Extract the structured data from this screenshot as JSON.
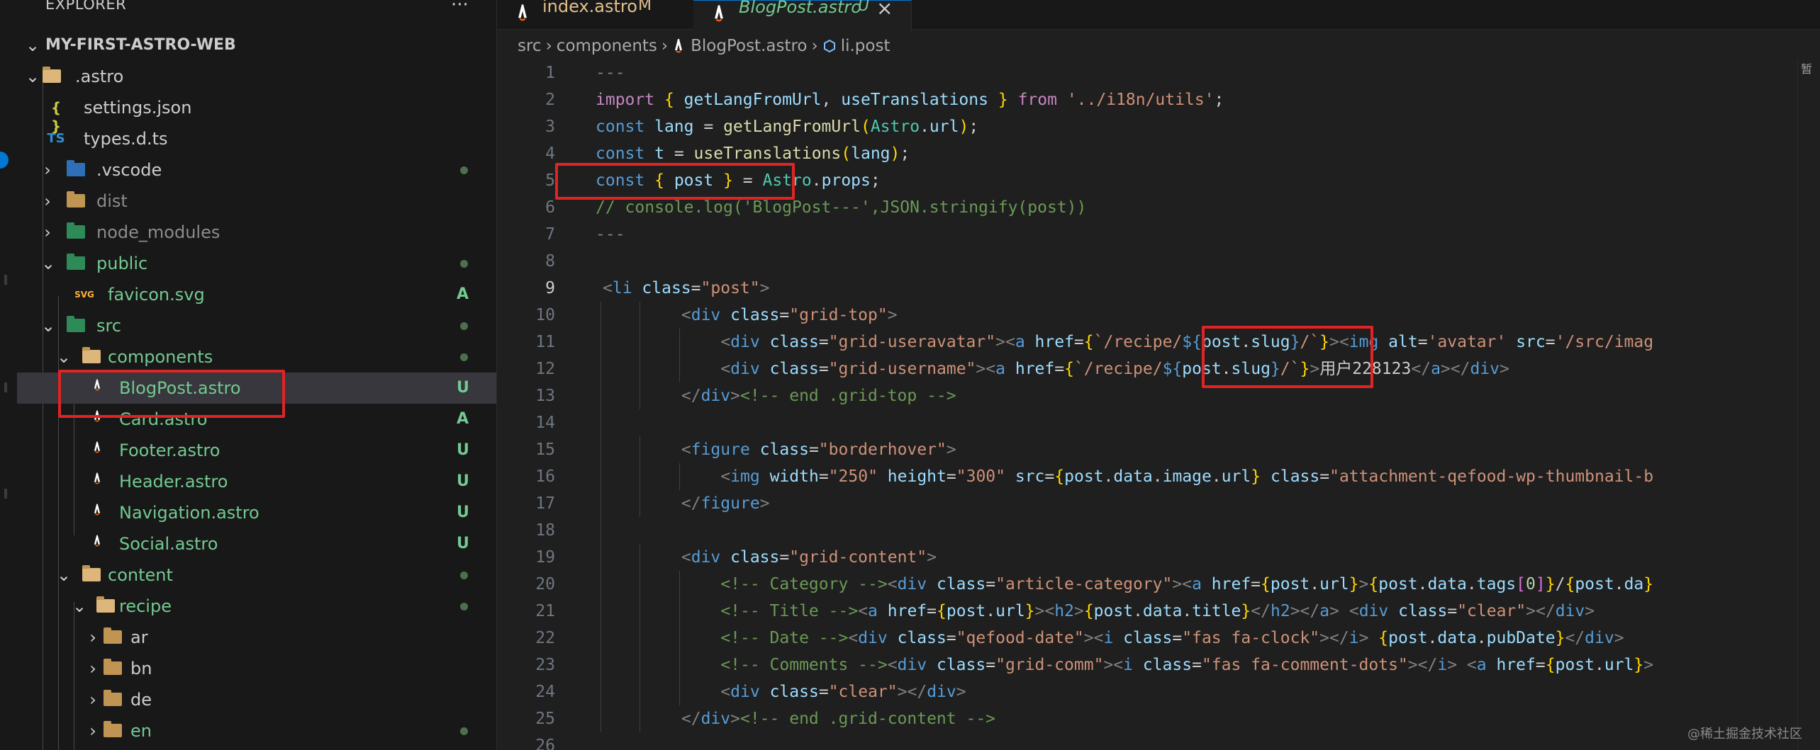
{
  "explorer": {
    "title": "EXPLORER",
    "more": "···",
    "tree": [
      {
        "label": "MY-FIRST-ASTRO-WEB",
        "badge": ""
      },
      {
        "label": ".astro",
        "badge": ""
      },
      {
        "label": "settings.json",
        "icon": "{ }",
        "badge": ""
      },
      {
        "label": "types.d.ts",
        "icon": "TS",
        "badge": ""
      },
      {
        "label": ".vscode",
        "badge": ""
      },
      {
        "label": "dist",
        "badge": ""
      },
      {
        "label": "node_modules",
        "badge": ""
      },
      {
        "label": "public",
        "badge": ""
      },
      {
        "label": "favicon.svg",
        "icon": "SVG",
        "badge": "A"
      },
      {
        "label": "src",
        "badge": ""
      },
      {
        "label": "components",
        "badge": ""
      },
      {
        "label": "BlogPost.astro",
        "badge": "U"
      },
      {
        "label": "Card.astro",
        "badge": "A"
      },
      {
        "label": "Footer.astro",
        "badge": "U"
      },
      {
        "label": "Header.astro",
        "badge": "U"
      },
      {
        "label": "Navigation.astro",
        "badge": "U"
      },
      {
        "label": "Social.astro",
        "badge": "U"
      },
      {
        "label": "content",
        "badge": ""
      },
      {
        "label": "recipe",
        "badge": ""
      },
      {
        "label": "ar",
        "badge": ""
      },
      {
        "label": "bn",
        "badge": ""
      },
      {
        "label": "de",
        "badge": ""
      },
      {
        "label": "en",
        "badge": ""
      }
    ]
  },
  "tabs": [
    {
      "label": "index.astro",
      "status": "M"
    },
    {
      "label": "BlogPost.astro",
      "status": "U",
      "close": "×"
    }
  ],
  "breadcrumb": {
    "items": [
      "src",
      "components",
      "BlogPost.astro",
      "li.post"
    ],
    "sep": "›"
  },
  "editor": {
    "line_numbers": [
      "1",
      "2",
      "3",
      "4",
      "5",
      "6",
      "7",
      "8",
      "9",
      "10",
      "11",
      "12",
      "13",
      "14",
      "15",
      "16",
      "17",
      "18",
      "19",
      "20",
      "21",
      "22",
      "23",
      "24",
      "25",
      "26"
    ],
    "lines": [
      "---",
      "import { getLangFromUrl, useTranslations } from '../i18n/utils';",
      "const lang = getLangFromUrl(Astro.url);",
      "const t = useTranslations(lang);",
      "const { post } = Astro.props;",
      "// console.log('BlogPost---',JSON.stringify(post))",
      "---",
      "",
      "<li class=\"post\">",
      "        <div class=\"grid-top\">",
      "            <div class=\"grid-useravatar\"><a href={`/recipe/${post.slug}/`}><img alt='avatar' src='/src/imag",
      "            <div class=\"grid-username\"><a href={`/recipe/${post.slug}/`}>用户228123</a></div>",
      "        </div><!-- end .grid-top -->",
      "",
      "        <figure class=\"borderhover\">",
      "            <img width=\"250\" height=\"300\" src={post.data.image.url} class=\"attachment-qefood-wp-thumbnail-b",
      "        </figure>",
      "",
      "        <div class=\"grid-content\">",
      "            <!-- Category --><div class=\"article-category\"><a href={post.url}>{post.data.tags[0]}/{post.dat",
      "            <!-- Title --><a href={post.url}><h2>{post.data.title}</h2></a> <div class=\"clear\"></div>",
      "            <!-- Date --><div class=\"qefood-date\"><i class=\"fas fa-clock\"></i> {post.data.pubDate}</div>",
      "            <!-- Comments --><div class=\"grid-comm\"><i class=\"fas fa-comment-dots\"></i> <a href={post.url}>",
      "            <div class=\"clear\"></div>",
      "        </div><!-- end .grid-content -->",
      ""
    ]
  },
  "minimap": {
    "text": "暂"
  },
  "watermark": "@稀土掘金技术社区",
  "colors": {
    "accent": "#0078d4",
    "highlight_box": "#e02424",
    "modified": "#e2c08d",
    "added": "#73c991"
  }
}
